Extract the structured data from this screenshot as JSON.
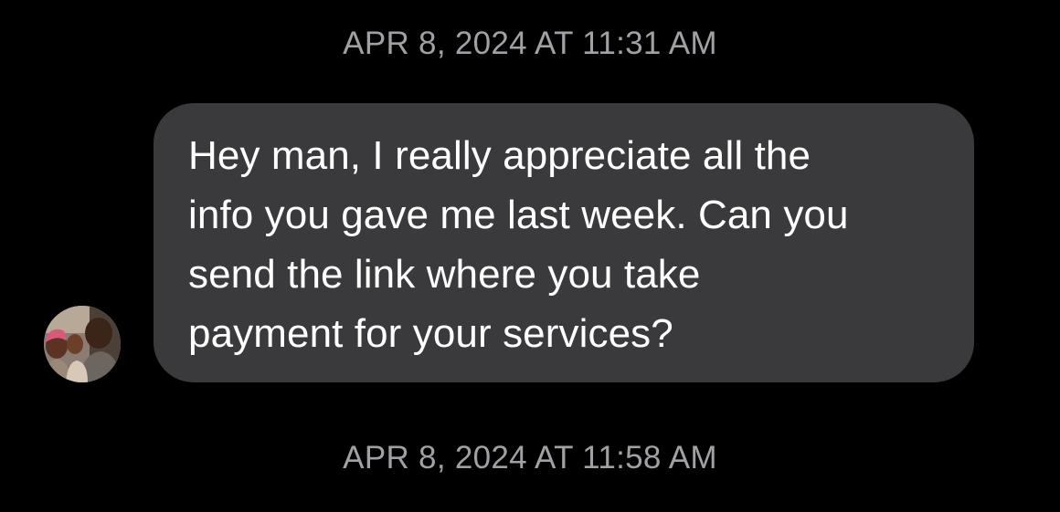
{
  "conversation": {
    "timestamps": [
      "APR 8, 2024 AT 11:31 AM",
      "APR 8, 2024 AT 11:58 AM"
    ],
    "incoming_message": {
      "lines": [
        "Hey man, I really appreciate all the",
        "info you gave me last week. Can you",
        "send the link where you take",
        "payment for your services?"
      ],
      "avatar_icon": "contact-photo-avatar"
    }
  },
  "colors": {
    "background": "#000000",
    "bubble": "#3a3a3c",
    "timestamp_text": "#a0a0a5",
    "message_text": "#ffffff"
  }
}
